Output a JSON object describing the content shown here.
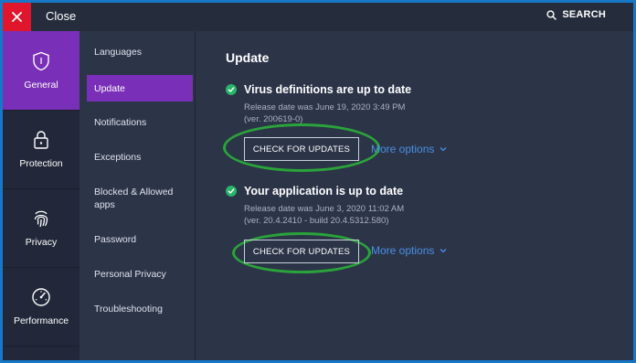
{
  "topbar": {
    "close_label": "Close",
    "search_label": "SEARCH"
  },
  "nav": {
    "items": [
      {
        "label": "General",
        "icon": "shield-icon",
        "active": true
      },
      {
        "label": "Protection",
        "icon": "lock-icon",
        "active": false
      },
      {
        "label": "Privacy",
        "icon": "fingerprint-icon",
        "active": false
      },
      {
        "label": "Performance",
        "icon": "speedometer-icon",
        "active": false
      }
    ]
  },
  "subnav": {
    "items": [
      {
        "label": "Languages"
      },
      {
        "label": "Update",
        "active": true
      },
      {
        "label": "Notifications"
      },
      {
        "label": "Exceptions"
      },
      {
        "label": "Blocked & Allowed apps"
      },
      {
        "label": "Password"
      },
      {
        "label": "Personal Privacy"
      },
      {
        "label": "Troubleshooting"
      }
    ]
  },
  "main": {
    "title": "Update",
    "virus": {
      "title": "Virus definitions are up to date",
      "release": "Release date was June 19, 2020 3:49 PM",
      "version": "(ver. 200619-0)",
      "button": "CHECK FOR UPDATES",
      "more": "More options"
    },
    "app": {
      "title": "Your application is up to date",
      "release": "Release date was June 3, 2020 11:02 AM",
      "version": "(ver. 20.4.2410 - build 20.4.5312.580)",
      "button": "CHECK FOR UPDATES",
      "more": "More options"
    }
  },
  "colors": {
    "accent": "#7a2fb8",
    "close_red": "#e0172c",
    "success_green": "#27b56a",
    "link_blue": "#4a90e2",
    "highlight_ring": "#2aa33a"
  }
}
